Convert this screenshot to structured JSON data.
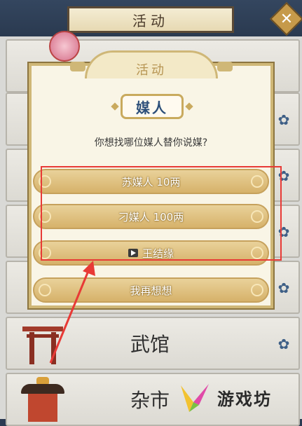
{
  "header": {
    "title": "活动",
    "close_icon": "close-icon"
  },
  "list": {
    "items": [
      {
        "label": ""
      },
      {
        "label": ""
      },
      {
        "label": ""
      },
      {
        "label": ""
      },
      {
        "label": ""
      },
      {
        "label": "武馆"
      },
      {
        "label": "杂市"
      }
    ]
  },
  "dialog": {
    "title": "活动",
    "subtitle": "媒人",
    "question": "你想找哪位媒人替你说媒?",
    "options": [
      {
        "label": "苏媒人 10两"
      },
      {
        "label": "刁媒人 100两"
      },
      {
        "label": "王结缘",
        "icon": "video-play-icon"
      },
      {
        "label": "我再想想"
      }
    ]
  },
  "annotation": {
    "highlight_color": "#e83a36",
    "arrow_color": "#e83a36"
  },
  "watermark": {
    "text": "游戏坊"
  }
}
